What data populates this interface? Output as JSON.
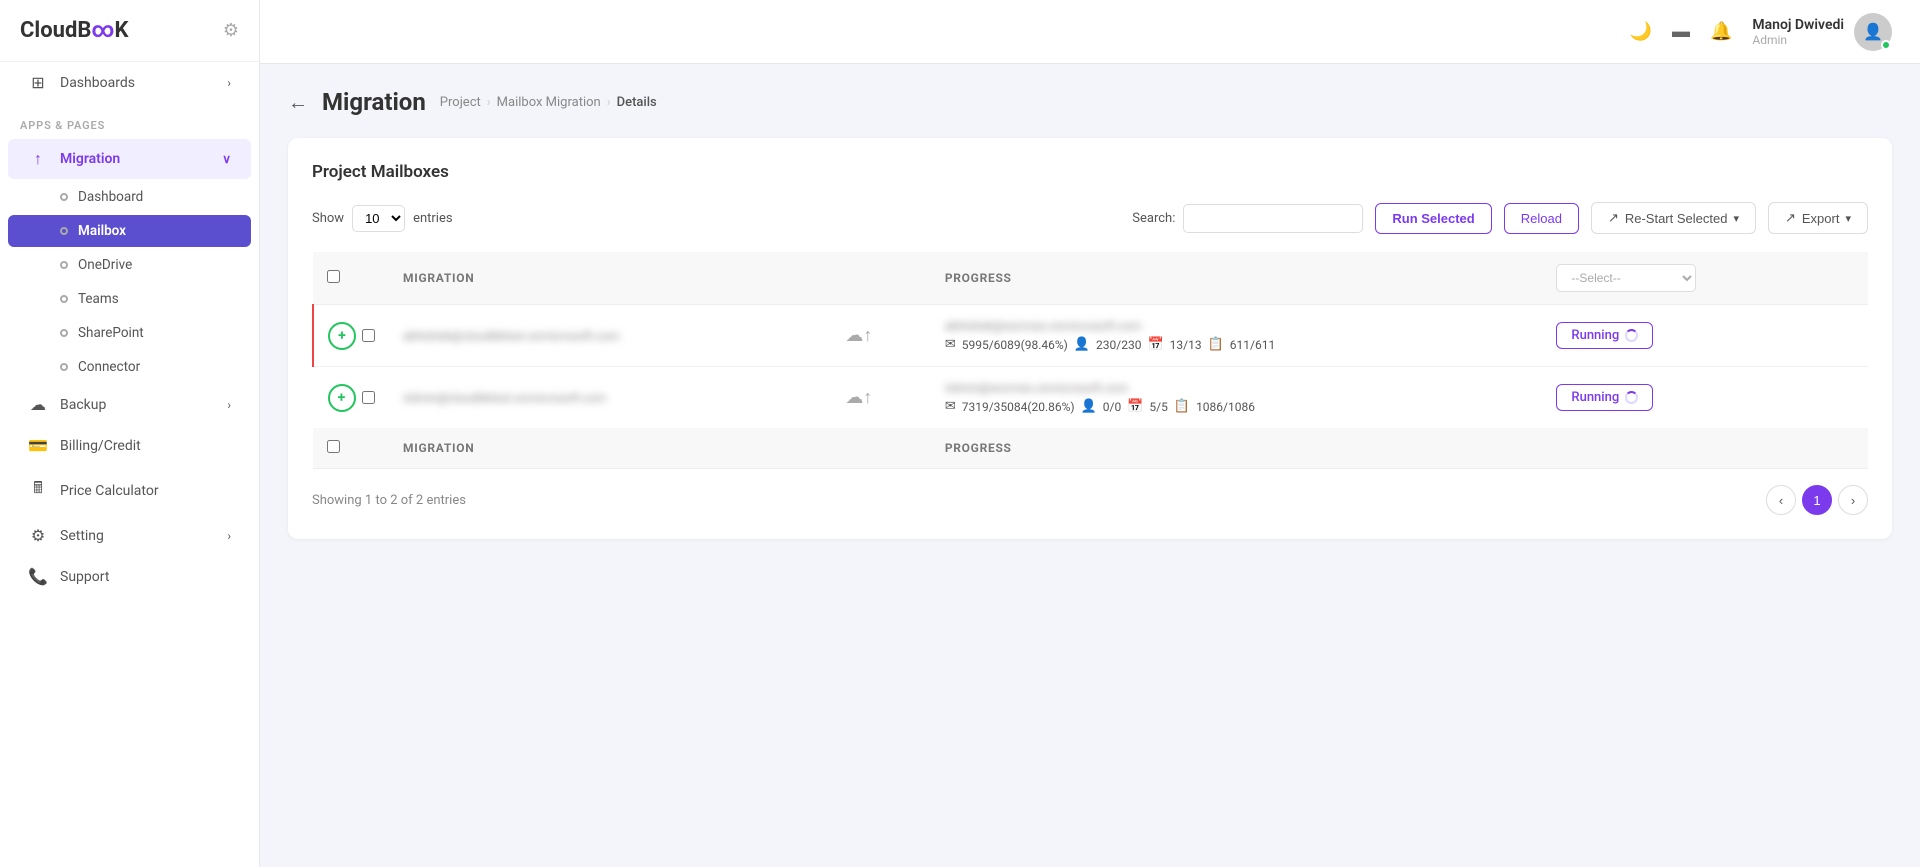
{
  "app": {
    "logo": "CloudB∞K",
    "logo_icon": "⚙"
  },
  "sidebar": {
    "section_label": "APPS & PAGES",
    "top_items": [
      {
        "id": "dashboards",
        "label": "Dashboards",
        "icon": "⊞",
        "has_chevron": true
      }
    ],
    "migration_items": [
      {
        "id": "migration",
        "label": "Migration",
        "icon": "↑",
        "has_chevron": true,
        "active": true
      },
      {
        "id": "dashboard",
        "label": "Dashboard",
        "is_sub": true
      },
      {
        "id": "mailbox",
        "label": "Mailbox",
        "is_sub": true,
        "selected": true
      },
      {
        "id": "onedrive",
        "label": "OneDrive",
        "is_sub": true
      },
      {
        "id": "teams",
        "label": "Teams",
        "is_sub": true
      },
      {
        "id": "sharepoint",
        "label": "SharePoint",
        "is_sub": true
      },
      {
        "id": "connector",
        "label": "Connector",
        "is_sub": true
      }
    ],
    "bottom_items": [
      {
        "id": "backup",
        "label": "Backup",
        "icon": "☁",
        "has_chevron": true
      },
      {
        "id": "billing",
        "label": "Billing/Credit",
        "icon": "▬"
      },
      {
        "id": "price-calc",
        "label": "Price Calculator",
        "icon": "⊟"
      },
      {
        "id": "setting",
        "label": "Setting",
        "icon": "⚙",
        "has_chevron": true
      },
      {
        "id": "support",
        "label": "Support",
        "icon": "📞"
      }
    ]
  },
  "topbar": {
    "dark_mode_icon": "🌙",
    "layout_icon": "▬",
    "bell_icon": "🔔",
    "user_name": "Manoj Dwivedi",
    "user_role": "Admin"
  },
  "page": {
    "back_label": "←",
    "title": "Migration",
    "breadcrumb": {
      "project": "Project",
      "mailbox_migration": "Mailbox Migration",
      "details": "Details"
    }
  },
  "card": {
    "title": "Project Mailboxes",
    "toolbar": {
      "show_label": "Show",
      "entries_value": "10",
      "entries_label": "entries",
      "search_label": "Search:",
      "search_placeholder": "",
      "run_selected_label": "Run Selected",
      "reload_label": "Reload",
      "restart_label": "Re-Start Selected",
      "export_label": "Export"
    },
    "table": {
      "columns": [
        "",
        "MIGRATION",
        "",
        "PROGRESS",
        "--Select--"
      ],
      "rows": [
        {
          "id": 1,
          "selected": true,
          "from_email": "abhishek@cloudbktest.onmicrosoft.com",
          "to_email": "abhishek@wormex.onmicrosoft.com",
          "progress_email": "5995/6089(98.46%)",
          "progress_contacts": "230/230",
          "progress_calendar": "13/13",
          "progress_tasks": "611/611",
          "status": "Running"
        },
        {
          "id": 2,
          "selected": false,
          "from_email": "Admin@cloudbktest.onmicrosoft.com",
          "to_email": "Admin@wormex.onmicrosoft.com",
          "progress_email": "7319/35084(20.86%)",
          "progress_contacts": "0/0",
          "progress_calendar": "5/5",
          "progress_tasks": "1086/1086",
          "status": "Running"
        }
      ]
    },
    "footer": {
      "showing_text": "Showing 1 to 2 of 2 entries",
      "page_current": "1"
    }
  }
}
